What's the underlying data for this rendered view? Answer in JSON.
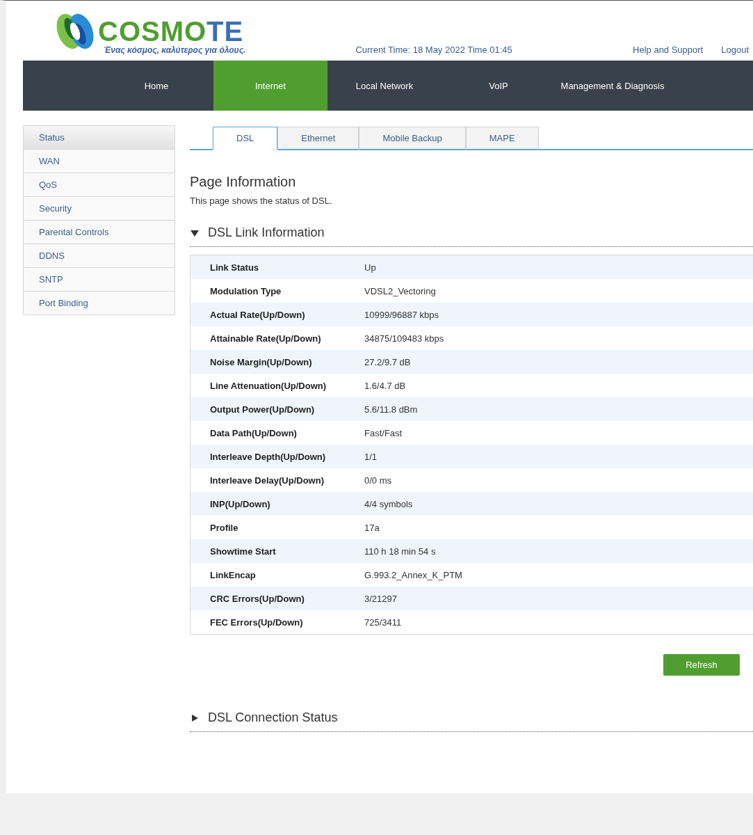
{
  "brand": {
    "name": "COSMOTE",
    "tagline": "Ένας κόσμος, καλύτερος για όλους."
  },
  "current_time": "Current Time: 18 May 2022 Time 01:45",
  "header_links": [
    "Help and Support",
    "Logout"
  ],
  "nav": [
    {
      "label": "Home",
      "selected": false
    },
    {
      "label": "Internet",
      "selected": true
    },
    {
      "label": "Local Network",
      "selected": false
    },
    {
      "label": "VoIP",
      "selected": false
    },
    {
      "label": "Management & Diagnosis",
      "selected": false
    }
  ],
  "sidebar": [
    {
      "label": "Status",
      "selected": true
    },
    {
      "label": "WAN",
      "selected": false
    },
    {
      "label": "QoS",
      "selected": false
    },
    {
      "label": "Security",
      "selected": false
    },
    {
      "label": "Parental Controls",
      "selected": false
    },
    {
      "label": "DDNS",
      "selected": false
    },
    {
      "label": "SNTP",
      "selected": false
    },
    {
      "label": "Port Binding",
      "selected": false
    }
  ],
  "tabs": [
    {
      "label": "DSL",
      "selected": true
    },
    {
      "label": "Ethernet",
      "selected": false
    },
    {
      "label": "Mobile Backup",
      "selected": false
    },
    {
      "label": "MAPE",
      "selected": false
    }
  ],
  "page_title": "Page Information",
  "page_description": "This page shows the status of DSL.",
  "sections": [
    {
      "title": "DSL Link Information",
      "expanded": true,
      "rows": [
        {
          "label": "Link Status",
          "value": "Up"
        },
        {
          "label": "Modulation Type",
          "value": "VDSL2_Vectoring"
        },
        {
          "label": "Actual Rate(Up/Down)",
          "value": "10999/96887 kbps"
        },
        {
          "label": "Attainable Rate(Up/Down)",
          "value": "34875/109483 kbps"
        },
        {
          "label": "Noise Margin(Up/Down)",
          "value": "27.2/9.7 dB"
        },
        {
          "label": "Line Attenuation(Up/Down)",
          "value": "1.6/4.7 dB"
        },
        {
          "label": "Output Power(Up/Down)",
          "value": "5.6/11.8 dBm"
        },
        {
          "label": "Data Path(Up/Down)",
          "value": "Fast/Fast"
        },
        {
          "label": "Interleave Depth(Up/Down)",
          "value": "1/1"
        },
        {
          "label": "Interleave Delay(Up/Down)",
          "value": "0/0 ms"
        },
        {
          "label": "INP(Up/Down)",
          "value": "4/4 symbols"
        },
        {
          "label": "Profile",
          "value": "17a"
        },
        {
          "label": "Showtime Start",
          "value": "110 h 18 min 54 s"
        },
        {
          "label": "LinkEncap",
          "value": "G.993.2_Annex_K_PTM"
        },
        {
          "label": "CRC Errors(Up/Down)",
          "value": "3/21297"
        },
        {
          "label": "FEC Errors(Up/Down)",
          "value": "725/3411"
        }
      ],
      "button": "Refresh"
    },
    {
      "title": "DSL Connection Status",
      "expanded": false
    }
  ]
}
